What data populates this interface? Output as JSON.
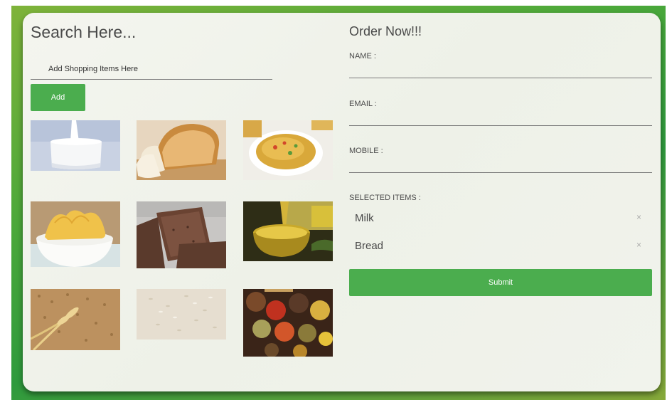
{
  "search": {
    "title": "Search Here...",
    "input_placeholder": "Add Shopping Items Here",
    "add_label": "Add"
  },
  "products": [
    {
      "name": "milk"
    },
    {
      "name": "bread"
    },
    {
      "name": "noodles"
    },
    {
      "name": "chips"
    },
    {
      "name": "biscuits"
    },
    {
      "name": "oil"
    },
    {
      "name": "wheat"
    },
    {
      "name": "rice"
    },
    {
      "name": "spices"
    }
  ],
  "order": {
    "title": "Order Now!!!",
    "name_label": "NAME :",
    "email_label": "EMAIL :",
    "mobile_label": "MOBILE :",
    "selected_label": "SELECTED ITEMS :",
    "selected_items": [
      "Milk",
      "Bread"
    ],
    "remove_glyph": "×",
    "submit_label": "Submit"
  },
  "colors": {
    "accent": "#4bad4e",
    "background_gradient": [
      "#7fb33a",
      "#2e9a3d"
    ],
    "card": "#f2f4ee"
  }
}
